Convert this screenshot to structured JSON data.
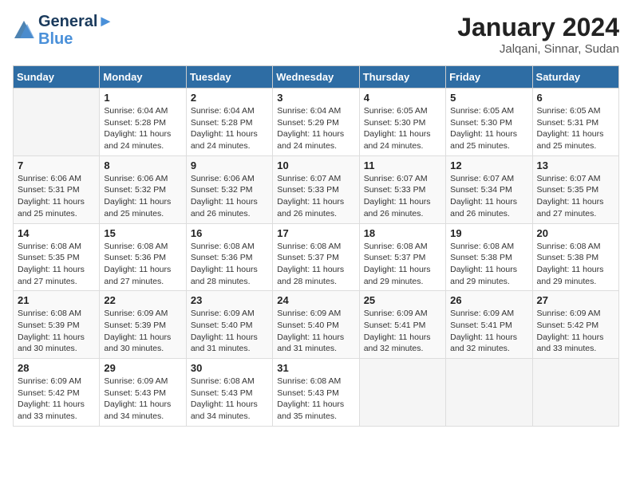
{
  "header": {
    "logo_line1": "General",
    "logo_line2": "Blue",
    "month_year": "January 2024",
    "location": "Jalqani, Sinnar, Sudan"
  },
  "weekdays": [
    "Sunday",
    "Monday",
    "Tuesday",
    "Wednesday",
    "Thursday",
    "Friday",
    "Saturday"
  ],
  "weeks": [
    [
      {
        "day": "",
        "sunrise": "",
        "sunset": "",
        "daylight": ""
      },
      {
        "day": "1",
        "sunrise": "Sunrise: 6:04 AM",
        "sunset": "Sunset: 5:28 PM",
        "daylight": "Daylight: 11 hours and 24 minutes."
      },
      {
        "day": "2",
        "sunrise": "Sunrise: 6:04 AM",
        "sunset": "Sunset: 5:28 PM",
        "daylight": "Daylight: 11 hours and 24 minutes."
      },
      {
        "day": "3",
        "sunrise": "Sunrise: 6:04 AM",
        "sunset": "Sunset: 5:29 PM",
        "daylight": "Daylight: 11 hours and 24 minutes."
      },
      {
        "day": "4",
        "sunrise": "Sunrise: 6:05 AM",
        "sunset": "Sunset: 5:30 PM",
        "daylight": "Daylight: 11 hours and 24 minutes."
      },
      {
        "day": "5",
        "sunrise": "Sunrise: 6:05 AM",
        "sunset": "Sunset: 5:30 PM",
        "daylight": "Daylight: 11 hours and 25 minutes."
      },
      {
        "day": "6",
        "sunrise": "Sunrise: 6:05 AM",
        "sunset": "Sunset: 5:31 PM",
        "daylight": "Daylight: 11 hours and 25 minutes."
      }
    ],
    [
      {
        "day": "7",
        "sunrise": "Sunrise: 6:06 AM",
        "sunset": "Sunset: 5:31 PM",
        "daylight": "Daylight: 11 hours and 25 minutes."
      },
      {
        "day": "8",
        "sunrise": "Sunrise: 6:06 AM",
        "sunset": "Sunset: 5:32 PM",
        "daylight": "Daylight: 11 hours and 25 minutes."
      },
      {
        "day": "9",
        "sunrise": "Sunrise: 6:06 AM",
        "sunset": "Sunset: 5:32 PM",
        "daylight": "Daylight: 11 hours and 26 minutes."
      },
      {
        "day": "10",
        "sunrise": "Sunrise: 6:07 AM",
        "sunset": "Sunset: 5:33 PM",
        "daylight": "Daylight: 11 hours and 26 minutes."
      },
      {
        "day": "11",
        "sunrise": "Sunrise: 6:07 AM",
        "sunset": "Sunset: 5:33 PM",
        "daylight": "Daylight: 11 hours and 26 minutes."
      },
      {
        "day": "12",
        "sunrise": "Sunrise: 6:07 AM",
        "sunset": "Sunset: 5:34 PM",
        "daylight": "Daylight: 11 hours and 26 minutes."
      },
      {
        "day": "13",
        "sunrise": "Sunrise: 6:07 AM",
        "sunset": "Sunset: 5:35 PM",
        "daylight": "Daylight: 11 hours and 27 minutes."
      }
    ],
    [
      {
        "day": "14",
        "sunrise": "Sunrise: 6:08 AM",
        "sunset": "Sunset: 5:35 PM",
        "daylight": "Daylight: 11 hours and 27 minutes."
      },
      {
        "day": "15",
        "sunrise": "Sunrise: 6:08 AM",
        "sunset": "Sunset: 5:36 PM",
        "daylight": "Daylight: 11 hours and 27 minutes."
      },
      {
        "day": "16",
        "sunrise": "Sunrise: 6:08 AM",
        "sunset": "Sunset: 5:36 PM",
        "daylight": "Daylight: 11 hours and 28 minutes."
      },
      {
        "day": "17",
        "sunrise": "Sunrise: 6:08 AM",
        "sunset": "Sunset: 5:37 PM",
        "daylight": "Daylight: 11 hours and 28 minutes."
      },
      {
        "day": "18",
        "sunrise": "Sunrise: 6:08 AM",
        "sunset": "Sunset: 5:37 PM",
        "daylight": "Daylight: 11 hours and 29 minutes."
      },
      {
        "day": "19",
        "sunrise": "Sunrise: 6:08 AM",
        "sunset": "Sunset: 5:38 PM",
        "daylight": "Daylight: 11 hours and 29 minutes."
      },
      {
        "day": "20",
        "sunrise": "Sunrise: 6:08 AM",
        "sunset": "Sunset: 5:38 PM",
        "daylight": "Daylight: 11 hours and 29 minutes."
      }
    ],
    [
      {
        "day": "21",
        "sunrise": "Sunrise: 6:08 AM",
        "sunset": "Sunset: 5:39 PM",
        "daylight": "Daylight: 11 hours and 30 minutes."
      },
      {
        "day": "22",
        "sunrise": "Sunrise: 6:09 AM",
        "sunset": "Sunset: 5:39 PM",
        "daylight": "Daylight: 11 hours and 30 minutes."
      },
      {
        "day": "23",
        "sunrise": "Sunrise: 6:09 AM",
        "sunset": "Sunset: 5:40 PM",
        "daylight": "Daylight: 11 hours and 31 minutes."
      },
      {
        "day": "24",
        "sunrise": "Sunrise: 6:09 AM",
        "sunset": "Sunset: 5:40 PM",
        "daylight": "Daylight: 11 hours and 31 minutes."
      },
      {
        "day": "25",
        "sunrise": "Sunrise: 6:09 AM",
        "sunset": "Sunset: 5:41 PM",
        "daylight": "Daylight: 11 hours and 32 minutes."
      },
      {
        "day": "26",
        "sunrise": "Sunrise: 6:09 AM",
        "sunset": "Sunset: 5:41 PM",
        "daylight": "Daylight: 11 hours and 32 minutes."
      },
      {
        "day": "27",
        "sunrise": "Sunrise: 6:09 AM",
        "sunset": "Sunset: 5:42 PM",
        "daylight": "Daylight: 11 hours and 33 minutes."
      }
    ],
    [
      {
        "day": "28",
        "sunrise": "Sunrise: 6:09 AM",
        "sunset": "Sunset: 5:42 PM",
        "daylight": "Daylight: 11 hours and 33 minutes."
      },
      {
        "day": "29",
        "sunrise": "Sunrise: 6:09 AM",
        "sunset": "Sunset: 5:43 PM",
        "daylight": "Daylight: 11 hours and 34 minutes."
      },
      {
        "day": "30",
        "sunrise": "Sunrise: 6:08 AM",
        "sunset": "Sunset: 5:43 PM",
        "daylight": "Daylight: 11 hours and 34 minutes."
      },
      {
        "day": "31",
        "sunrise": "Sunrise: 6:08 AM",
        "sunset": "Sunset: 5:43 PM",
        "daylight": "Daylight: 11 hours and 35 minutes."
      },
      {
        "day": "",
        "sunrise": "",
        "sunset": "",
        "daylight": ""
      },
      {
        "day": "",
        "sunrise": "",
        "sunset": "",
        "daylight": ""
      },
      {
        "day": "",
        "sunrise": "",
        "sunset": "",
        "daylight": ""
      }
    ]
  ]
}
